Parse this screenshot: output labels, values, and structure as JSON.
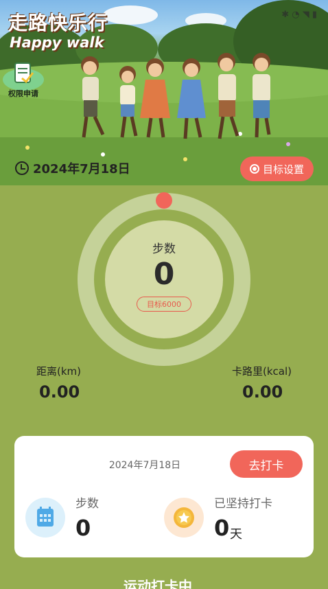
{
  "header": {
    "title": "走路快乐行",
    "subtitle": "Happy walk",
    "permission_label": "权限申请",
    "date": "2024年7月18日",
    "goal_button": "目标设置"
  },
  "progress": {
    "steps_label": "步数",
    "steps_value": "0",
    "target_label": "目标6000",
    "fraction": 0
  },
  "metrics": {
    "distance_label": "距离(km)",
    "distance_value": "0.00",
    "calories_label": "卡路里(kcal)",
    "calories_value": "0.00"
  },
  "checkin_card": {
    "date": "2024年7月18日",
    "button": "去打卡",
    "steps_label": "步数",
    "steps_value": "0",
    "streak_label": "已坚持打卡",
    "streak_value": "0",
    "streak_unit": "天"
  },
  "footer": {
    "peek_text": "运动打卡中"
  },
  "colors": {
    "background": "#96ad50",
    "accent": "#f1665a",
    "ring_light": "#c5d299"
  }
}
